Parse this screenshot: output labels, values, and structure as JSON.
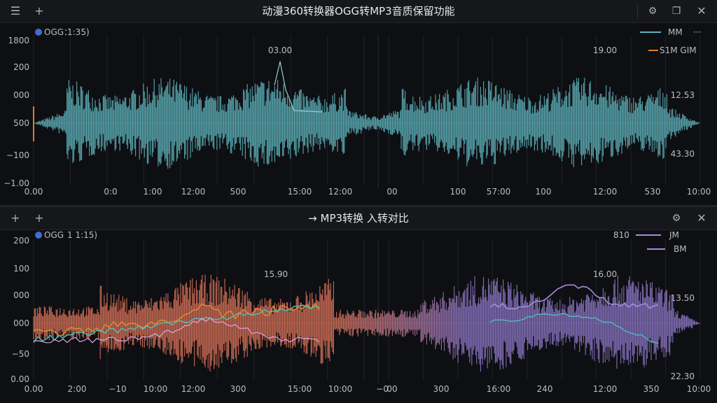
{
  "top": {
    "title": "动漫360转换器OGG转MP3音质保留功能",
    "menu_icon": "menu-icon",
    "add_icon": "plus-icon",
    "actions": [
      "settings-icon",
      "restore-icon",
      "close-icon"
    ],
    "legend_left": {
      "label": "OGG：",
      "value": "1:35)"
    },
    "legend_right": {
      "label": "MM",
      "more": "···"
    },
    "left_chart": {
      "y_ticks": [
        "1800",
        "200",
        "000",
        "500",
        "−100",
        "−1.00"
      ],
      "x_ticks": [
        "0.00",
        "0:0",
        "1:00",
        "12:00",
        "500",
        "15:00",
        "12:00"
      ],
      "peak_label": "03.00"
    },
    "right_chart": {
      "y_ticks_right": [
        "12.53",
        "43.30"
      ],
      "x_ticks": [
        "00",
        "100",
        "57:00",
        "100",
        "12:00",
        "530",
        "10:00"
      ],
      "peak_label": "19.00",
      "legend": "S1M GIM"
    },
    "colors": {
      "waveform": "#5fb4bd",
      "accent": "#e27d2e",
      "legend_left": "#3c6fd4"
    }
  },
  "bottom": {
    "title": "MP3转换 入转对比",
    "title_prefix": "→",
    "add_icons": [
      "plus-icon",
      "plus-icon"
    ],
    "actions": [
      "settings-icon",
      "close-icon"
    ],
    "legend_left": {
      "label": "OGG",
      "value": "1 1:15)"
    },
    "legend_right": {
      "label1": "810",
      "label2": "JM",
      "label3": "BM"
    },
    "left_chart": {
      "y_ticks": [
        "200",
        "100",
        "000",
        "000",
        "−50",
        "0.00"
      ],
      "x_ticks": [
        "0.00",
        "2:00",
        "−10",
        "10:00",
        "12:00",
        "300",
        "15:00",
        "10:00"
      ],
      "peak_label": "15.90"
    },
    "right_chart": {
      "y_ticks_right": [
        "13.50",
        "22.30"
      ],
      "x_ticks": [
        "−0",
        "00",
        "300",
        "16:00",
        "240",
        "12:00",
        "350",
        "10:00"
      ],
      "peak_label": "16.00"
    },
    "colors": {
      "waveform_left": "#d9735a",
      "waveform_right": "#8d77c8",
      "line_orange": "#e0902e",
      "line_teal": "#4fc3bb",
      "line_pink": "#d8a8e6",
      "line_purple": "#6a4a9a"
    }
  }
}
